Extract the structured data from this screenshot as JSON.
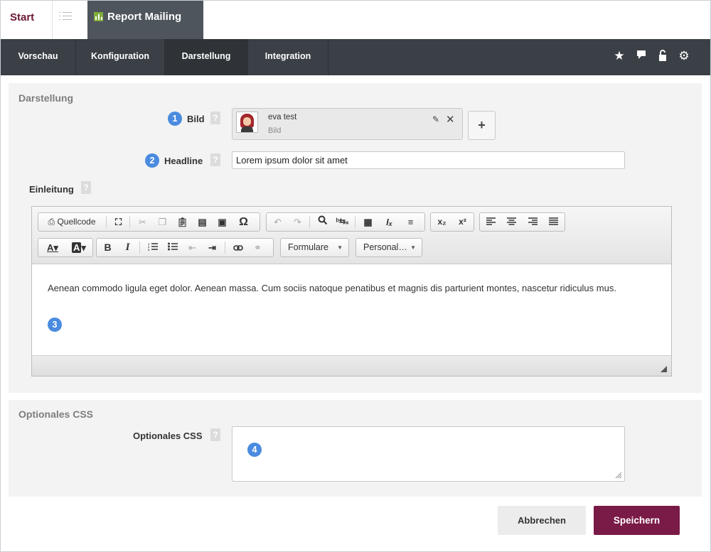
{
  "top_tabs": {
    "start_label": "Start",
    "report_label": "Report Mailing"
  },
  "nav": {
    "items": [
      {
        "label": "Vorschau"
      },
      {
        "label": "Konfiguration"
      },
      {
        "label": "Darstellung"
      },
      {
        "label": "Integration"
      }
    ],
    "active": "Darstellung",
    "icons": [
      "star-icon",
      "comment-icon",
      "unlock-icon",
      "gear-icon"
    ]
  },
  "darstellung": {
    "title": "Darstellung",
    "bild": {
      "badge": "1",
      "label": "Bild",
      "help": "?",
      "image_name": "eva test",
      "image_type": "Bild"
    },
    "headline": {
      "badge": "2",
      "label": "Headline",
      "help": "?",
      "value": "Lorem ipsum dolor sit amet"
    },
    "einleitung": {
      "label": "Einleitung",
      "help": "?",
      "badge": "3",
      "toolbar": {
        "source_label": "Quellcode",
        "format_combo": "Formulare",
        "personal_combo": "Personal…"
      },
      "content": "Aenean commodo ligula eget dolor. Aenean massa. Cum sociis natoque penatibus et magnis dis parturient montes, nascetur ridiculus mus."
    }
  },
  "optional_css": {
    "title": "Optionales CSS",
    "label": "Optionales CSS",
    "help": "?",
    "badge": "4",
    "value": ""
  },
  "actions": {
    "cancel_label": "Abbrechen",
    "save_label": "Speichern"
  },
  "colors": {
    "brand": "#7a1a46",
    "nav_bg": "#3b4046",
    "badge": "#4a8be0"
  }
}
